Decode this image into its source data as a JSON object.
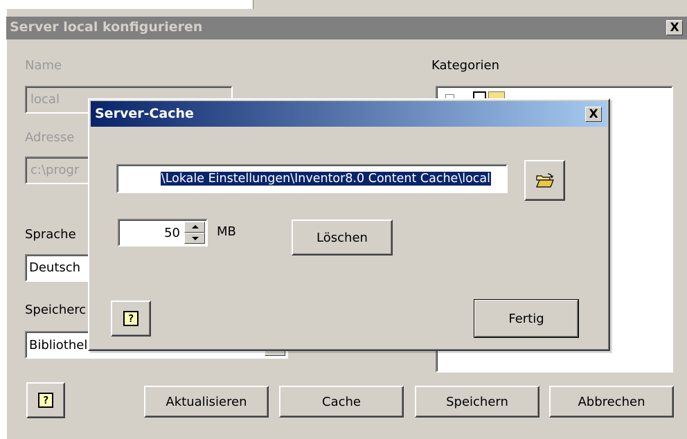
{
  "outer": {
    "title": "Server local konfigurieren",
    "name_label": "Name",
    "name_value": "local",
    "address_label": "Adresse",
    "address_value": "c:\\progr",
    "language_label": "Sprache",
    "language_value": "Deutsch",
    "storage_label": "Speicherc",
    "storage_value": "Bibliothel",
    "categories_label": "Kategorien",
    "help_glyph": "?",
    "buttons": {
      "refresh": "Aktualisieren",
      "cache": "Cache",
      "save": "Speichern",
      "cancel": "Abbrechen"
    },
    "close_glyph": "X"
  },
  "dialog": {
    "title": "Server-Cache",
    "close_glyph": "X",
    "path_value": "\\Lokale Einstellungen\\Inventor8.0 Content Cache\\local",
    "size_value": "50",
    "size_unit": "MB",
    "delete_button": "Löschen",
    "help_glyph": "?",
    "done_button": "Fertig",
    "icons": {
      "browse": "folder-open-icon",
      "help": "help-icon"
    }
  },
  "colors": {
    "title_inactive": "#808080",
    "title_active_start": "#0a246a",
    "title_active_end": "#a6caf0",
    "selection": "#0a246a",
    "face": "#d4d0c8"
  }
}
